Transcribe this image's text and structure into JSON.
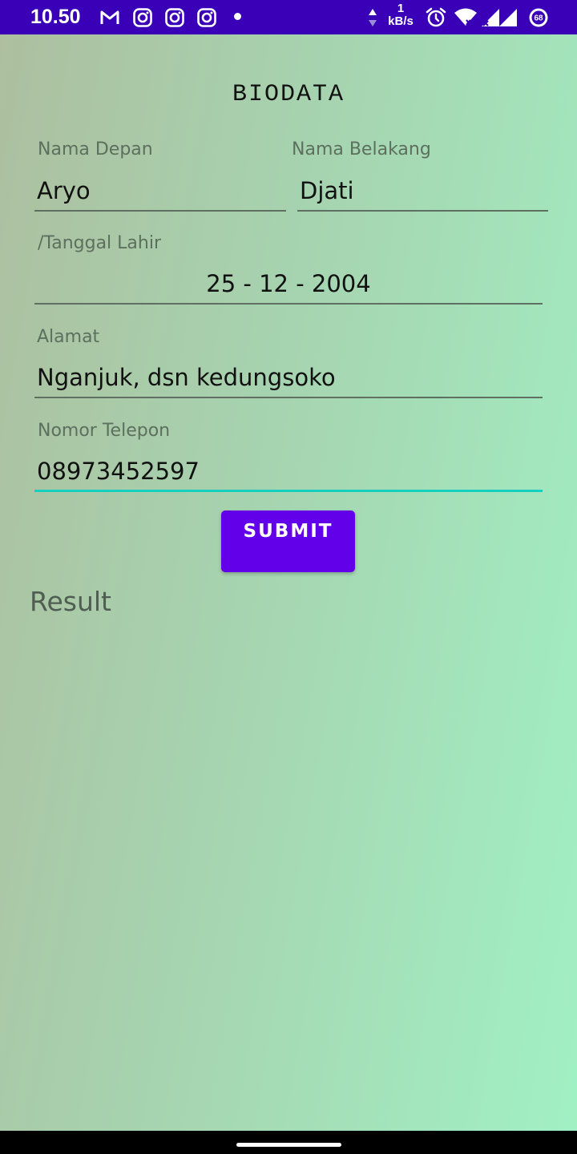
{
  "status_bar": {
    "time": "10.50",
    "speed_value": "1",
    "speed_unit": "kB/s",
    "battery_level": "68",
    "icons": [
      "gmail-icon",
      "instagram-icon",
      "instagram-icon",
      "instagram-icon",
      "notification-dot-icon",
      "data-arrows-icon",
      "alarm-icon",
      "wifi-icon",
      "cellular-signal-icon",
      "battery-icon"
    ]
  },
  "form": {
    "title": "BIODATA",
    "first_name_label": "Nama Depan",
    "first_name_value": "Aryo",
    "last_name_label": "Nama Belakang",
    "last_name_value": "Djati",
    "birth_date_label": "/Tanggal Lahir",
    "birth_date_value": "25 - 12 - 2004",
    "address_label": "Alamat",
    "address_value": "Nganjuk, dsn kedungsoko",
    "phone_label": "Nomor Telepon",
    "phone_value": "08973452597",
    "submit_label": "SUBMIT",
    "result_label": "Result"
  },
  "colors": {
    "status_bar": "#3a00b8",
    "button": "#6200ea",
    "focused_underline": "#17cfc0",
    "gradient_left": "#adbf9f",
    "gradient_right": "#a1f0c4"
  }
}
